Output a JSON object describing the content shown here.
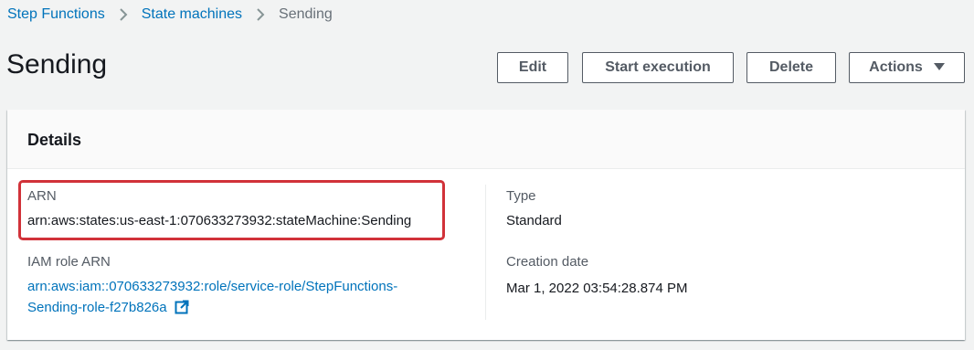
{
  "breadcrumb": {
    "items": [
      "Step Functions",
      "State machines"
    ],
    "current": "Sending"
  },
  "page": {
    "title": "Sending"
  },
  "actions": {
    "edit": "Edit",
    "start_execution": "Start execution",
    "delete": "Delete",
    "actions": "Actions"
  },
  "details": {
    "title": "Details",
    "arn_label": "ARN",
    "arn_value": "arn:aws:states:us-east-1:070633273932:stateMachine:Sending",
    "iam_label": "IAM role ARN",
    "iam_value_line1": "arn:aws:iam::070633273932:role/service-role/StepFunctions-",
    "iam_value_line2": "Sending-role-f27b826a",
    "type_label": "Type",
    "type_value": "Standard",
    "creation_label": "Creation date",
    "creation_value": "Mar 1, 2022 03:54:28.874 PM"
  },
  "colors": {
    "link": "#0073bb",
    "highlight": "#d13239"
  },
  "icons": [
    "chevron-right-icon",
    "caret-down-icon",
    "external-link-icon"
  ]
}
